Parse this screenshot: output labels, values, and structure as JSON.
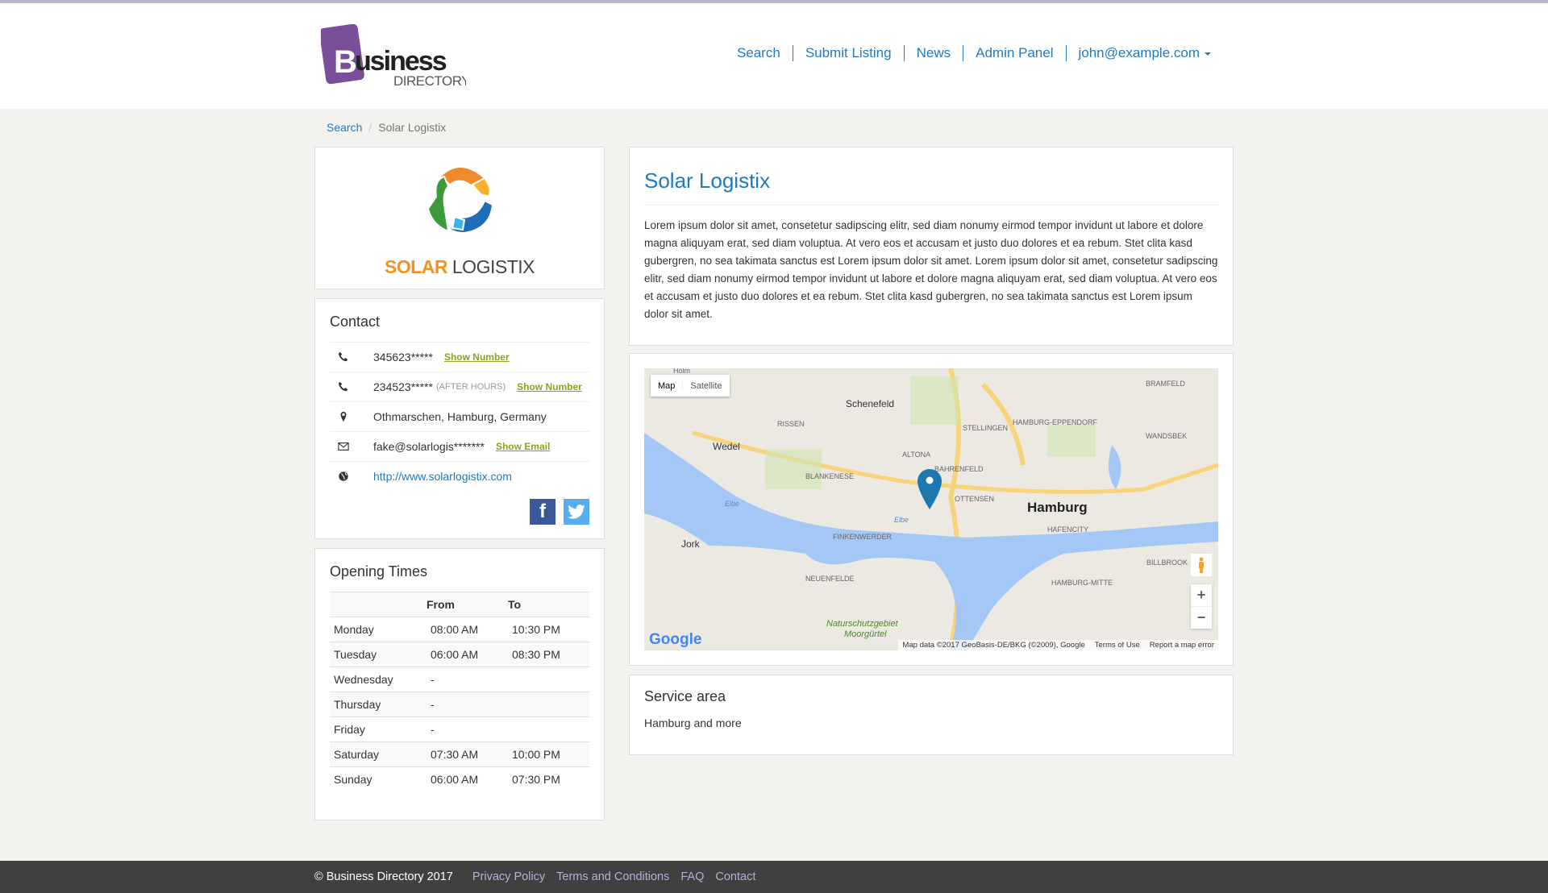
{
  "header": {
    "logo_text": "Business",
    "logo_sub": "DIRECTORY",
    "nav": [
      {
        "label": "Search"
      },
      {
        "label": "Submit Listing"
      },
      {
        "label": "News"
      },
      {
        "label": "Admin Panel"
      },
      {
        "label": "john@example.com"
      }
    ]
  },
  "breadcrumb": {
    "items": [
      {
        "label": "Search"
      },
      {
        "label": "Solar Logistix"
      }
    ]
  },
  "company_logo": {
    "word1": "SOLAR",
    "word2": "LOGISTIX"
  },
  "contact": {
    "title": "Contact",
    "rows": [
      {
        "icon": "phone-icon",
        "text": "345623*****",
        "note": "",
        "action": "Show Number"
      },
      {
        "icon": "phone-icon",
        "text": "234523*****",
        "note": "(AFTER HOURS)",
        "action": "Show Number"
      },
      {
        "icon": "map-marker-icon",
        "text": "Othmarschen, Hamburg, Germany",
        "note": "",
        "action": ""
      },
      {
        "icon": "envelope-icon",
        "text": "fake@solarlogis*******",
        "note": "",
        "action": "Show Email"
      },
      {
        "icon": "globe-icon",
        "text": "http://www.solarlogistix.com",
        "note": "",
        "action": ""
      }
    ],
    "social": [
      "facebook",
      "twitter"
    ]
  },
  "opening": {
    "title": "Opening Times",
    "headers": [
      "",
      "From",
      "To"
    ],
    "rows": [
      [
        "Monday",
        "08:00 AM",
        "10:30 PM"
      ],
      [
        "Tuesday",
        "06:00 AM",
        "08:30 PM"
      ],
      [
        "Wednesday",
        "-",
        ""
      ],
      [
        "Thursday",
        "-",
        ""
      ],
      [
        "Friday",
        "-",
        ""
      ],
      [
        "Saturday",
        "07:30 AM",
        "10:00 PM"
      ],
      [
        "Sunday",
        "06:00 AM",
        "07:30 PM"
      ]
    ]
  },
  "listing": {
    "title": "Solar Logistix",
    "description": "Lorem ipsum dolor sit amet, consetetur sadipscing elitr, sed diam nonumy eirmod tempor invidunt ut labore et dolore magna aliquyam erat, sed diam voluptua. At vero eos et accusam et justo duo dolores et ea rebum. Stet clita kasd gubergren, no sea takimata sanctus est Lorem ipsum dolor sit amet. Lorem ipsum dolor sit amet, consetetur sadipscing elitr, sed diam nonumy eirmod tempor invidunt ut labore et dolore magna aliquyam erat, sed diam voluptua. At vero eos et accusam et justo duo dolores et ea rebum. Stet clita kasd gubergren, no sea takimata sanctus est Lorem ipsum dolor sit amet."
  },
  "map": {
    "type_map": "Map",
    "type_satellite": "Satellite",
    "attribution": "Map data ©2017 GeoBasis-DE/BKG (©2009), Google",
    "terms": "Terms of Use",
    "report": "Report a map error",
    "google": "Google",
    "zoom_in": "+",
    "zoom_out": "−",
    "labels": {
      "holm": "Holm",
      "schenefeld": "Schenefeld",
      "rissen": "RISSEN",
      "wedel": "Wedel",
      "altona": "ALTONA",
      "bahrenfeld": "BAHRENFELD",
      "blankenese": "BLANKENESE",
      "ottensen": "OTTENSEN",
      "hamburg": "Hamburg",
      "hafencity": "HAFENCITY",
      "stellingen": "STELLINGEN",
      "eppendorf": "HAMBURG-EPPENDORF",
      "wandsbek": "WANDSBEK",
      "bramfeld": "BRAMFELD",
      "finkenwerder": "FINKENWERDER",
      "jork": "Jork",
      "neuenfelde": "NEUENFELDE",
      "billbrook": "BILLBROOK",
      "mitte": "HAMBURG-MITTE",
      "nsg1": "Naturschutzgebiet",
      "nsg2": "Moorgürtel",
      "elbe": "Elbe",
      "elbe2": "Elbe"
    }
  },
  "service": {
    "title": "Service area",
    "text": "Hamburg and more"
  },
  "footer": {
    "copyright": "© Business Directory 2017",
    "links": [
      "Privacy Policy",
      "Terms and Conditions",
      "FAQ",
      "Contact"
    ]
  },
  "colors": {
    "link": "#1f7ac2",
    "accent_green": "#8aa31f",
    "footer_bg": "#404040",
    "brand_purple": "#7a4f9a"
  }
}
